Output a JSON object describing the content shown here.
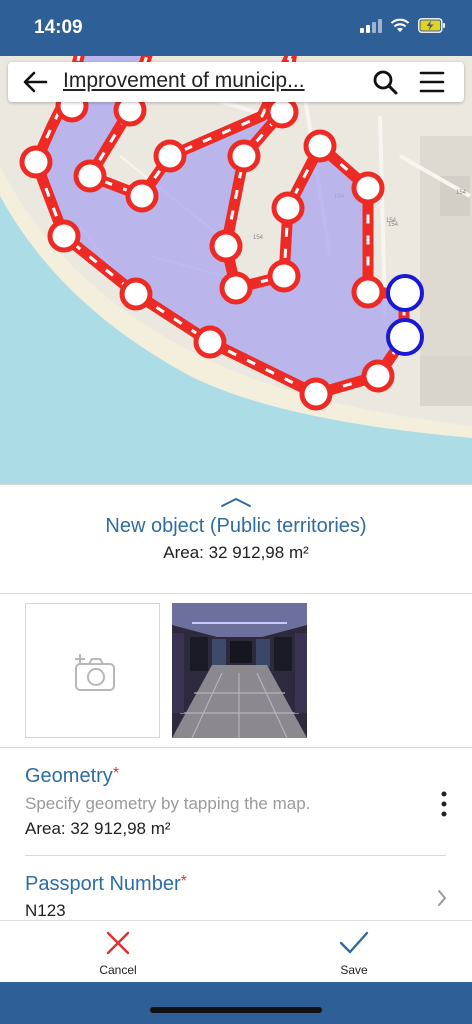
{
  "status_bar": {
    "time": "14:09",
    "battery_level": 0.6
  },
  "header": {
    "title": "Improvement of municip...",
    "back_icon": "arrow-left-icon",
    "search_icon": "search-icon",
    "menu_icon": "hamburger-menu-icon"
  },
  "map": {
    "polygon_color": "#a9a6f0",
    "edge_color": "#ee2a24",
    "vertex_selected_color": "#1a18d6",
    "labels": [
      "154",
      "154",
      "154",
      "154",
      "154"
    ]
  },
  "object": {
    "title": "New object (Public territories)",
    "area_text": "Area: 32 912,98  m²"
  },
  "photos": {
    "add_icon": "add-photo-camera-icon"
  },
  "fields": {
    "geometry": {
      "label": "Geometry",
      "required_mark": "*",
      "hint": "Specify geometry by tapping the map.",
      "value": "Area: 32 912,98  m²",
      "menu_icon": "more-vertical-icon"
    },
    "passport": {
      "label": "Passport Number",
      "required_mark": "*",
      "value": "N123",
      "chevron_icon": "chevron-right-icon"
    }
  },
  "actions": {
    "cancel_label": "Cancel",
    "save_label": "Save",
    "cancel_color": "#e03030",
    "save_color": "#2e6da4"
  },
  "colors": {
    "brand_bar": "#2f5f97",
    "accent_text": "#2e6da4"
  }
}
